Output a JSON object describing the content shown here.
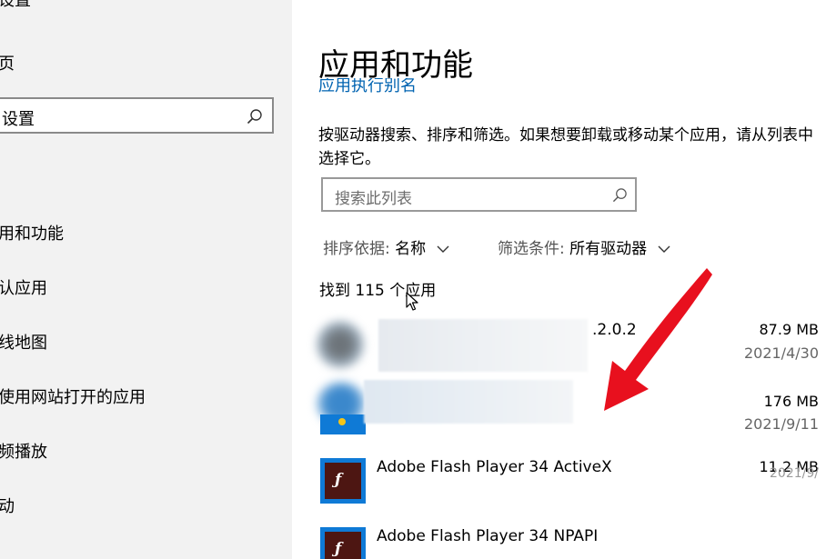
{
  "sidebar": {
    "top_partial": "设置",
    "home": "页",
    "search_placeholder": "设置",
    "nav": [
      {
        "label": "用和功能"
      },
      {
        "label": "认应用"
      },
      {
        "label": "线地图"
      },
      {
        "label": "使用网站打开的应用"
      },
      {
        "label": "频播放"
      },
      {
        "label": "动"
      }
    ]
  },
  "main": {
    "title": "应用和功能",
    "clipped_link": "应用执行别名",
    "description": "按驱动器搜索、排序和筛选。如果想要卸载或移动某个应用，请从列表中选择它。",
    "search_placeholder": "搜索此列表",
    "sort": {
      "label": "排序依据:",
      "value": "名称"
    },
    "filter": {
      "label": "筛选条件:",
      "value": "所有驱动器"
    },
    "count": "找到 115 个应用",
    "apps": [
      {
        "name_visible": ".2.0.2",
        "size": "87.9 MB",
        "date": "2021/4/30"
      },
      {
        "size": "176 MB",
        "date": "2021/9/11"
      },
      {
        "name": "Adobe Flash Player 34 ActiveX",
        "size": "11.2 MB"
      },
      {
        "name": "Adobe Flash Player 34 NPAPI"
      }
    ],
    "partial_date": "2021/9/"
  },
  "icons": {
    "search": "search-icon",
    "chevron": "chevron-down-icon",
    "flash": "flash-icon",
    "cursor": "mouse-cursor-icon",
    "arrow": "red-arrow-annotation"
  },
  "colors": {
    "accent_link": "#0063b1",
    "sidebar_bg": "#f2f2f2",
    "flash_blue": "#0f7ad6",
    "flash_dark": "#4d1612",
    "annotation_red": "#e8101e"
  }
}
